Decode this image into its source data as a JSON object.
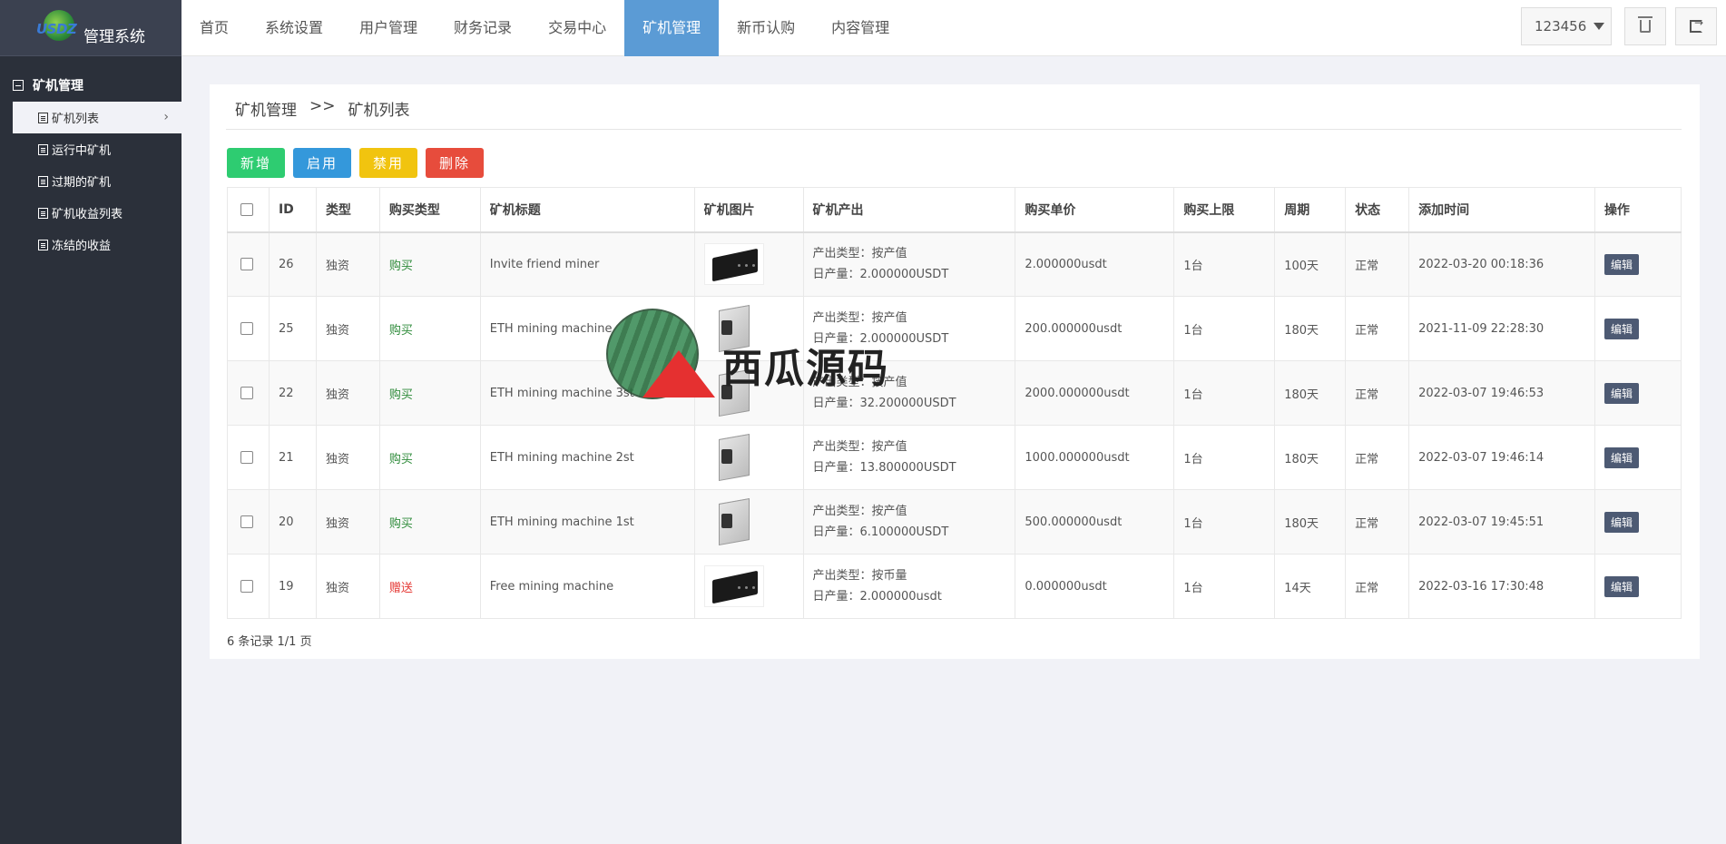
{
  "app": {
    "logo_text": "USDZ",
    "title": "管理系统"
  },
  "nav": [
    "首页",
    "系统设置",
    "用户管理",
    "财务记录",
    "交易中心",
    "矿机管理",
    "新币认购",
    "内容管理"
  ],
  "user": {
    "name": "123456"
  },
  "sidebar": {
    "group": "矿机管理",
    "items": [
      "矿机列表",
      "运行中矿机",
      "过期的矿机",
      "矿机收益列表",
      "冻结的收益"
    ]
  },
  "breadcrumb": {
    "parent": "矿机管理",
    "sep": ">>",
    "current": "矿机列表"
  },
  "buttons": {
    "add": "新增",
    "enable": "启用",
    "disable": "禁用",
    "delete": "删除"
  },
  "table": {
    "headers": [
      "ID",
      "类型",
      "购买类型",
      "矿机标题",
      "矿机图片",
      "矿机产出",
      "购买单价",
      "购买上限",
      "周期",
      "状态",
      "添加时间",
      "操作"
    ],
    "rows": [
      {
        "id": "26",
        "type": "独资",
        "buy_type": "购买",
        "title": "Invite friend miner",
        "img": "black",
        "out_type": "产出类型：按产值",
        "daily": "日产量：2.000000USDT",
        "price": "2.000000usdt",
        "limit": "1台",
        "period": "100天",
        "status": "正常",
        "time": "2022-03-20 00:18:36",
        "action": "编辑"
      },
      {
        "id": "25",
        "type": "独资",
        "buy_type": "购买",
        "title": "ETH mining machine",
        "img": "silver",
        "out_type": "产出类型：按产值",
        "daily": "日产量：2.000000USDT",
        "price": "200.000000usdt",
        "limit": "1台",
        "period": "180天",
        "status": "正常",
        "time": "2021-11-09 22:28:30",
        "action": "编辑"
      },
      {
        "id": "22",
        "type": "独资",
        "buy_type": "购买",
        "title": "ETH mining machine 3st",
        "img": "silver",
        "out_type": "产出类型：按产值",
        "daily": "日产量：32.200000USDT",
        "price": "2000.000000usdt",
        "limit": "1台",
        "period": "180天",
        "status": "正常",
        "time": "2022-03-07 19:46:53",
        "action": "编辑"
      },
      {
        "id": "21",
        "type": "独资",
        "buy_type": "购买",
        "title": "ETH mining machine 2st",
        "img": "silver",
        "out_type": "产出类型：按产值",
        "daily": "日产量：13.800000USDT",
        "price": "1000.000000usdt",
        "limit": "1台",
        "period": "180天",
        "status": "正常",
        "time": "2022-03-07 19:46:14",
        "action": "编辑"
      },
      {
        "id": "20",
        "type": "独资",
        "buy_type": "购买",
        "title": "ETH mining machine 1st",
        "img": "silver",
        "out_type": "产出类型：按产值",
        "daily": "日产量：6.100000USDT",
        "price": "500.000000usdt",
        "limit": "1台",
        "period": "180天",
        "status": "正常",
        "time": "2022-03-07 19:45:51",
        "action": "编辑"
      },
      {
        "id": "19",
        "type": "独资",
        "buy_type": "赠送",
        "title": "Free mining machine",
        "img": "black",
        "out_type": "产出类型：按币量",
        "daily": "日产量：2.000000usdt",
        "price": "0.000000usdt",
        "limit": "1台",
        "period": "14天",
        "status": "正常",
        "time": "2022-03-16 17:30:48",
        "action": "编辑"
      }
    ]
  },
  "footer": "6 条记录 1/1 页",
  "watermark": "西瓜源码",
  "colors": {
    "accent": "#5b9bd5",
    "sidebar": "#2b303a",
    "buy": "#2e8b3a",
    "gift": "#e53935"
  }
}
